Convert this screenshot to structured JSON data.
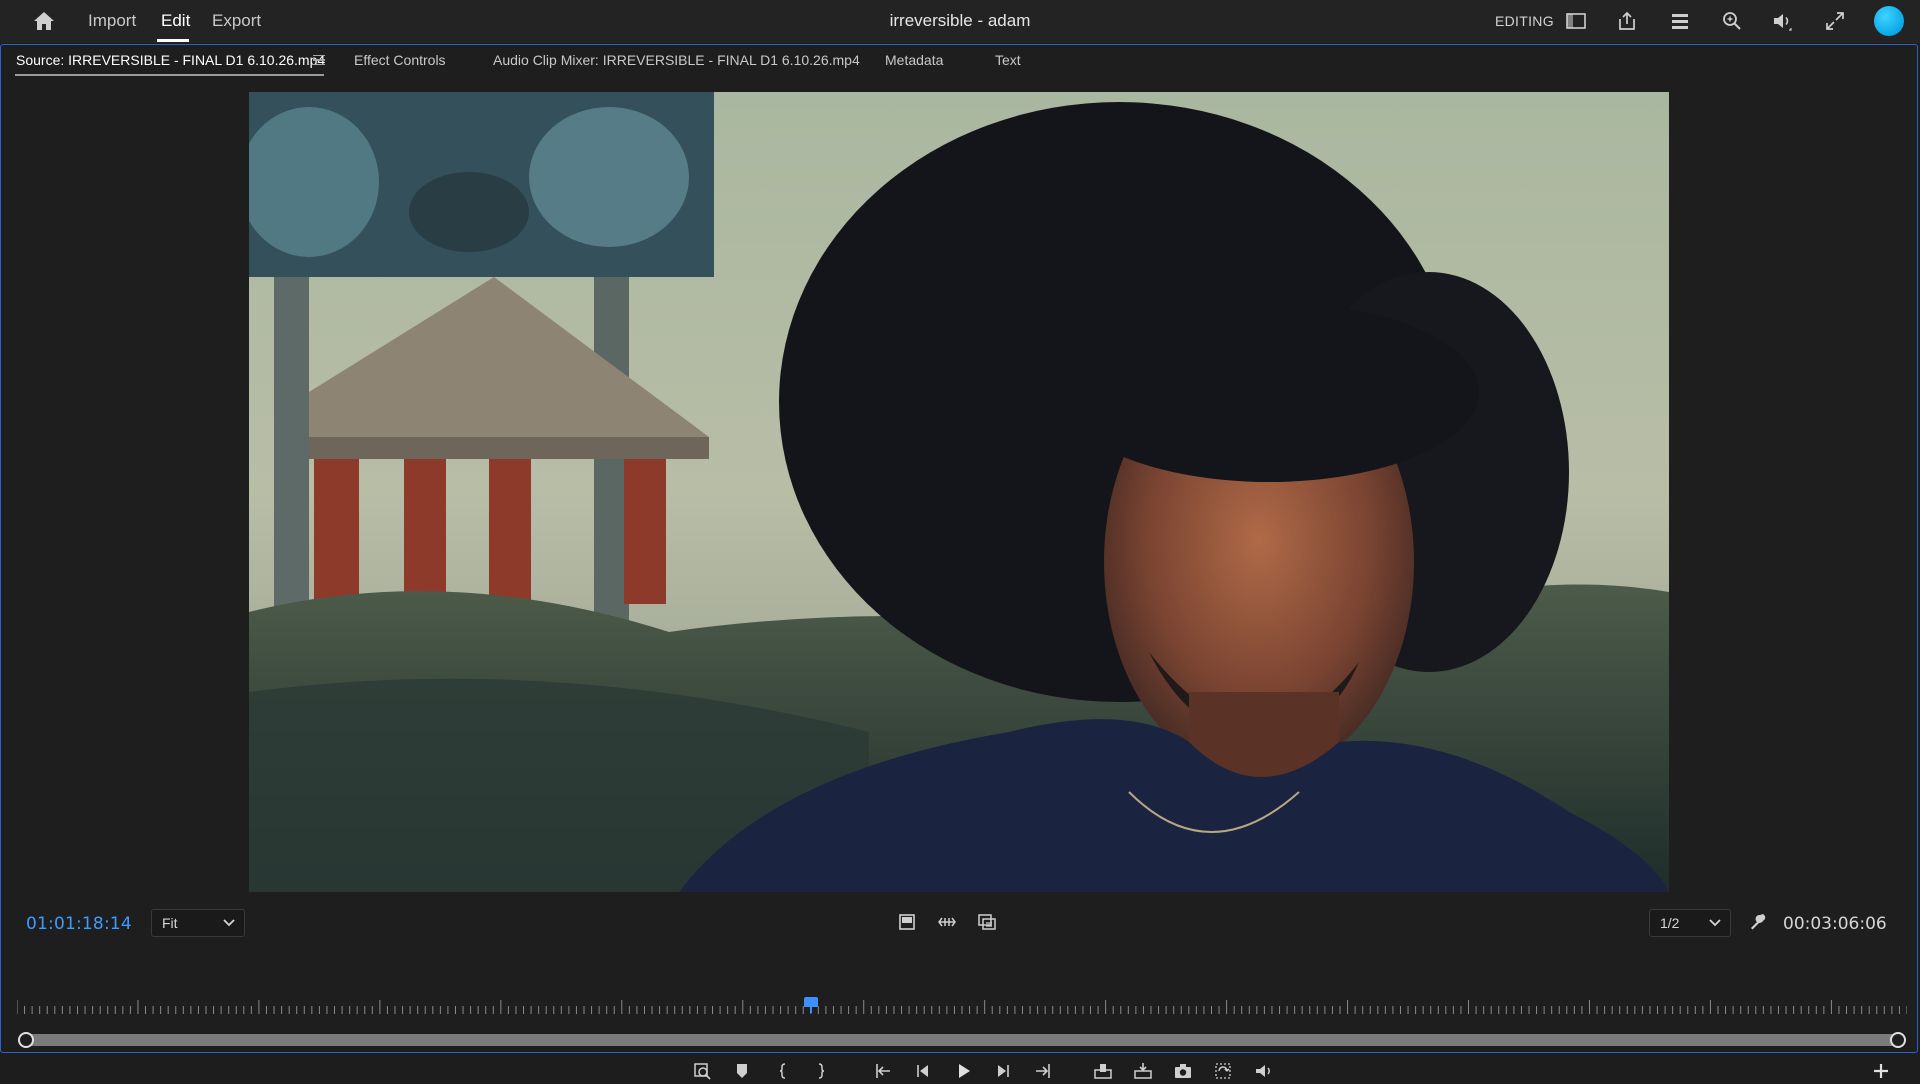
{
  "app": {
    "title": "irreversible - adam",
    "workspace": "EDITING",
    "accent_color": "#2b64c8",
    "avatar_color": "#13b3f0"
  },
  "nav": {
    "items": [
      {
        "label": "Import"
      },
      {
        "label": "Edit",
        "active": true
      },
      {
        "label": "Export"
      }
    ]
  },
  "toolbar_icons": [
    "workspace-panel-icon",
    "share-icon",
    "quick-settings-icon",
    "search-icon",
    "volume-icon",
    "fullscreen-icon"
  ],
  "tabs": [
    {
      "label": "Source: IRREVERSIBLE - FINAL D1 6.10.26.mp4",
      "active": true
    },
    {
      "label": "Effect Controls"
    },
    {
      "label": "Audio Clip Mixer: IRREVERSIBLE - FINAL D1 6.10.26.mp4"
    },
    {
      "label": "Metadata"
    },
    {
      "label": "Text"
    }
  ],
  "monitor": {
    "current_timecode": "01:01:18:14",
    "duration_timecode": "00:03:06:06",
    "zoom_value": "Fit",
    "resolution_value": "1/2",
    "playhead_fraction": 0.42
  },
  "controls": {
    "middle": [
      "drag-video-icon",
      "drag-audio-icon",
      "export-frame-icon"
    ],
    "transport": [
      "insert-icon",
      "add-marker-icon",
      "mark-in-icon",
      "mark-out-icon",
      "go-to-in-icon",
      "step-back-icon",
      "play-icon",
      "step-forward-icon",
      "go-to-out-icon",
      "insert-clip-icon",
      "overwrite-clip-icon",
      "export-frame-camera-icon",
      "loop-icon",
      "audio-icon"
    ]
  }
}
